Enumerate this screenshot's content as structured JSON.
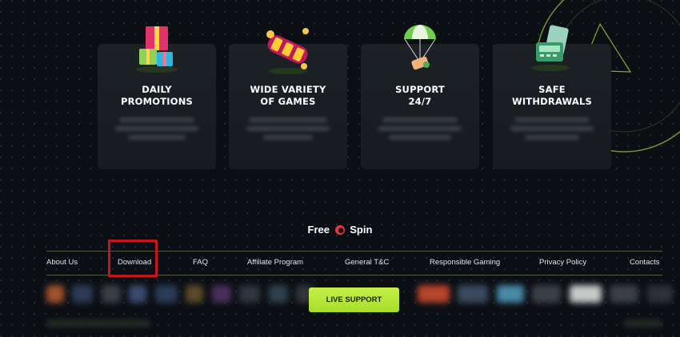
{
  "features": [
    {
      "title_line1": "DAILY",
      "title_line2": "PROMOTIONS",
      "icon": "gift-boxes-icon"
    },
    {
      "title_line1": "WIDE VARIETY",
      "title_line2": "OF GAMES",
      "icon": "slot-reel-icon"
    },
    {
      "title_line1": "SUPPORT",
      "title_line2": "24/7",
      "icon": "parachute-money-icon"
    },
    {
      "title_line1": "SAFE",
      "title_line2": "WITHDRAWALS",
      "icon": "card-terminal-icon"
    }
  ],
  "brand": {
    "part1": "Free",
    "part2": "Spin",
    "logo_icon": "red-ring-logo-icon"
  },
  "footer_nav": [
    {
      "label": "About Us"
    },
    {
      "label": "Download"
    },
    {
      "label": "FAQ"
    },
    {
      "label": "Affiliate Program"
    },
    {
      "label": "General T&C"
    },
    {
      "label": "Responsible Gaming"
    },
    {
      "label": "Privacy Policy"
    },
    {
      "label": "Contacts"
    }
  ],
  "live_support_label": "LIVE SUPPORT",
  "colors": {
    "background": "#0b0f14",
    "card": "#1c2126",
    "accent": "#b8e63a",
    "highlight": "#c4161c"
  }
}
